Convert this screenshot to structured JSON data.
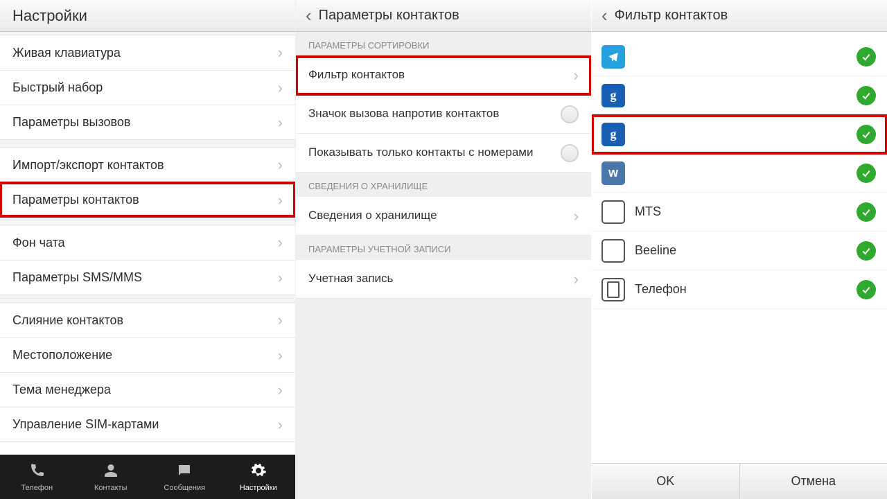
{
  "pane1": {
    "title": "Настройки",
    "groups": [
      {
        "items": [
          {
            "label": "Живая клавиатура",
            "hl": false
          },
          {
            "label": "Быстрый набор",
            "hl": false
          },
          {
            "label": "Параметры вызовов",
            "hl": false
          }
        ]
      },
      {
        "items": [
          {
            "label": "Импорт/экспорт контактов",
            "hl": false
          },
          {
            "label": "Параметры контактов",
            "hl": true
          }
        ]
      },
      {
        "items": [
          {
            "label": "Фон чата",
            "hl": false
          },
          {
            "label": "Параметры SMS/MMS",
            "hl": false
          }
        ]
      },
      {
        "items": [
          {
            "label": "Слияние контактов",
            "hl": false
          },
          {
            "label": "Местоположение",
            "hl": false
          },
          {
            "label": "Тема менеджера",
            "hl": false
          },
          {
            "label": "Управление SIM-картами",
            "hl": false
          }
        ]
      }
    ],
    "nav": [
      {
        "label": "Телефон",
        "icon": "phone"
      },
      {
        "label": "Контакты",
        "icon": "contact"
      },
      {
        "label": "Сообщения",
        "icon": "sms"
      },
      {
        "label": "Настройки",
        "icon": "gear",
        "active": true
      }
    ]
  },
  "pane2": {
    "title": "Параметры контактов",
    "sections": [
      {
        "header": "ПАРАМЕТРЫ СОРТИРОВКИ",
        "rows": [
          {
            "label": "Фильтр контактов",
            "type": "nav",
            "hl": true
          },
          {
            "label": "Значок вызова напротив контактов",
            "type": "toggle",
            "on": false
          },
          {
            "label": "Показывать только контакты с номерами",
            "type": "toggle",
            "on": false
          }
        ]
      },
      {
        "header": "СВЕДЕНИЯ О ХРАНИЛИЩЕ",
        "rows": [
          {
            "label": "Сведения о хранилище",
            "type": "nav"
          }
        ]
      },
      {
        "header": "ПАРАМЕТРЫ УЧЕТНОЙ ЗАПИСИ",
        "rows": [
          {
            "label": "Учетная запись",
            "type": "nav"
          }
        ]
      }
    ]
  },
  "pane3": {
    "title": "Фильтр контактов",
    "accounts": [
      {
        "icon": "telegram",
        "label": "",
        "blur": "w1",
        "checked": true,
        "hl": false
      },
      {
        "icon": "google",
        "label": "",
        "blur": "w2",
        "checked": true,
        "hl": false
      },
      {
        "icon": "google",
        "label": "",
        "blur": "w3",
        "checked": true,
        "hl": true
      },
      {
        "icon": "vk",
        "label": "",
        "blur": "w4",
        "checked": true,
        "hl": false
      },
      {
        "icon": "sim",
        "label": "MTS",
        "checked": true,
        "hl": false
      },
      {
        "icon": "sim",
        "label": "Beeline",
        "checked": true,
        "hl": false
      },
      {
        "icon": "phone",
        "label": "Телефон",
        "checked": true,
        "hl": false
      }
    ],
    "buttons": {
      "ok": "OK",
      "cancel": "Отмена"
    }
  }
}
